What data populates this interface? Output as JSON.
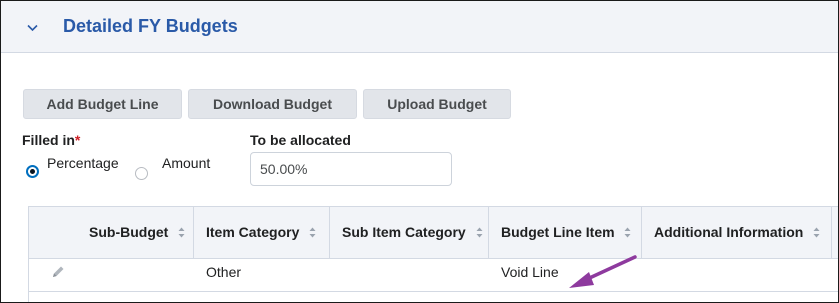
{
  "section": {
    "title": "Detailed FY Budgets"
  },
  "toolbar": {
    "add_label": "Add Budget Line",
    "download_label": "Download Budget",
    "upload_label": "Upload Budget"
  },
  "filled_in": {
    "label": "Filled in",
    "required_mark": "*",
    "options": [
      "Percentage",
      "Amount"
    ],
    "selected": "Percentage"
  },
  "to_be_allocated": {
    "label": "To be allocated",
    "value": "50.00%"
  },
  "table": {
    "columns": [
      "Sub-Budget",
      "Item Category",
      "Sub Item Category",
      "Budget Line Item",
      "Additional Information"
    ],
    "rows": [
      {
        "sub_budget": "",
        "item_category": "Other",
        "sub_item_category": "",
        "budget_line_item": "Void Line",
        "additional_information": ""
      }
    ]
  },
  "colors": {
    "accent": "#2a5aa8",
    "annotation_arrow": "#8e3a9e",
    "radio_selected": "#006fbf"
  },
  "icons": [
    "chevron-down-icon",
    "sort-icon",
    "pencil-icon",
    "annotation-arrow"
  ]
}
